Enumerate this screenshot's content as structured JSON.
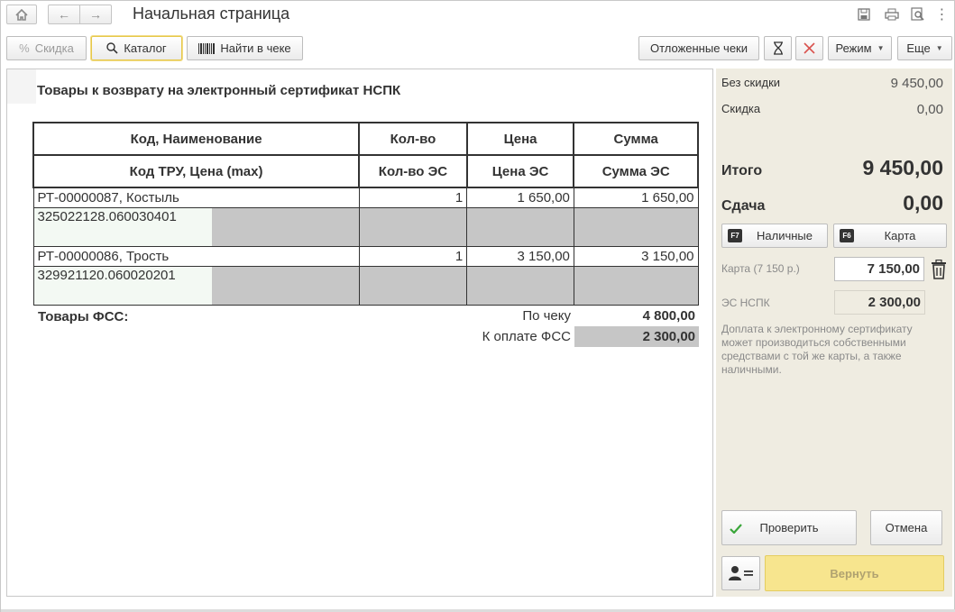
{
  "titlebar": {
    "title": "Начальная страница",
    "icons": [
      "home-icon",
      "back-arrow-icon",
      "forward-arrow-icon",
      "save-icon",
      "print-icon",
      "preview-icon",
      "more-icon"
    ]
  },
  "toolbar": {
    "discount": "Скидка",
    "catalog": "Каталог",
    "find_in_receipt": "Найти в чеке",
    "deferred": "Отложенные чеки",
    "mode": "Режим",
    "more": "Еще"
  },
  "document": {
    "title": "Товары к возврату на электронный сертификат НСПК",
    "headers_row1": [
      "Код, Наименование",
      "Кол-во",
      "Цена",
      "Сумма"
    ],
    "headers_row2": [
      "Код ТРУ, Цена (max)",
      "Кол-во ЭС",
      "Цена ЭС",
      "Сумма ЭС"
    ],
    "items": [
      {
        "name": "РТ-00000087, Костыль",
        "qty": "1",
        "price": "1 650,00",
        "sum": "1 650,00",
        "tru_code": "325022128.060030401"
      },
      {
        "name": "РТ-00000086, Трость",
        "qty": "1",
        "price": "3 150,00",
        "sum": "3 150,00",
        "tru_code": "329921120.060020201"
      }
    ],
    "fss_label": "Товары ФСС:",
    "by_receipt_label": "По чеку",
    "by_receipt_value": "4 800,00",
    "to_pay_fss_label": "К оплате ФСС",
    "to_pay_fss_value": "2 300,00"
  },
  "summary": {
    "no_discount_label": "Без скидки",
    "no_discount_value": "9 450,00",
    "discount_label": "Скидка",
    "discount_value": "0,00",
    "total_label": "Итого",
    "total_value": "9 450,00",
    "change_label": "Сдача",
    "change_value": "0,00",
    "cash_key": "F7",
    "cash_label": "Наличные",
    "card_key": "F6",
    "card_label": "Карта",
    "card_field_label": "Карта (7 150 р.)",
    "card_field_value": "7 150,00",
    "es_label": "ЭС НСПК",
    "es_value": "2 300,00",
    "note": "Доплата к электронному сертификату может производиться собственными средствами с той же карты, а также наличными.",
    "check_label": "Проверить",
    "cancel_label": "Отмена",
    "return_label": "Вернуть"
  },
  "colors": {
    "right_panel_bg": "#efece1",
    "gray_cell": "#c6c6c6",
    "return_button": "#f7e58e",
    "check_mark": "#3aa63a",
    "clear_x": "#d9534f"
  }
}
